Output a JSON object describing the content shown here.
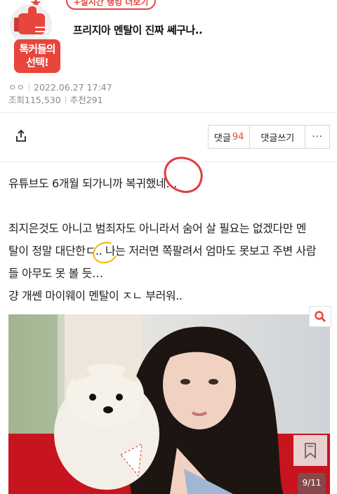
{
  "header": {
    "realtime_label": "+실시간 랭킹 더보기",
    "badge_line1": "톡커들의",
    "badge_line2": "선택!",
    "title": "프리지아 멘탈이 진짜 쎄구나.."
  },
  "meta": {
    "author": "ㅇㅇ",
    "date": "2022.06.27 17:47",
    "views": "조회115,530",
    "recommend": "추천291"
  },
  "actions": {
    "comment_label": "댓글",
    "comment_count": "94",
    "write_comment_label": "댓글쓰기",
    "more_label": "···"
  },
  "body": {
    "line1": "유튜브도 6개월 되가니까 복귀했네…",
    "line2": "죄지은것도 아니고 범죄자도 아니라서 숨어 살 필요는 없겠다만 멘",
    "line3": "탈이 정말 대단한ㄷ.. 나는 저러면 쪽팔려서 엄마도 못보고 주변 사람",
    "line4": "들 아무도 못 볼 듯…",
    "line5": "걍 개쎈 마이웨이 멘탈이 ㅈㄴ 부러워.."
  },
  "image": {
    "counter": "9/11"
  },
  "colors": {
    "accent": "#e8453c",
    "meta_text": "#8a8a8a",
    "annotation_red": "#e23b3b",
    "annotation_yellow": "#f0b400"
  },
  "icons": [
    "share-icon",
    "zoom-icon",
    "bookmark-icon",
    "star-icon",
    "thumbs-up-icon"
  ]
}
